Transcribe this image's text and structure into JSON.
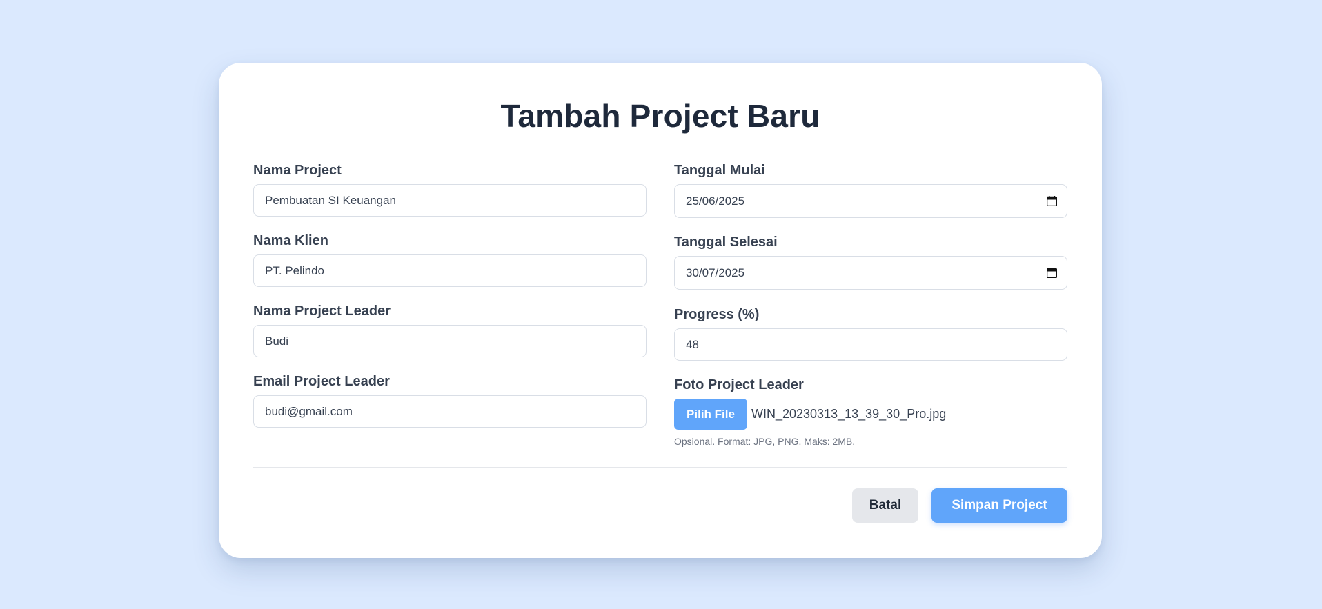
{
  "form": {
    "title": "Tambah Project Baru",
    "nama_project": {
      "label": "Nama Project",
      "value": "Pembuatan SI Keuangan"
    },
    "nama_klien": {
      "label": "Nama Klien",
      "value": "PT. Pelindo"
    },
    "nama_leader": {
      "label": "Nama Project Leader",
      "value": "Budi"
    },
    "email_leader": {
      "label": "Email Project Leader",
      "value": "budi@gmail.com"
    },
    "tanggal_mulai": {
      "label": "Tanggal Mulai",
      "value": "25/06/2025"
    },
    "tanggal_selesai": {
      "label": "Tanggal Selesai",
      "value": "30/07/2025"
    },
    "progress": {
      "label": "Progress (%)",
      "value": "48"
    },
    "foto": {
      "label": "Foto Project Leader",
      "button_label": "Pilih File",
      "file_name": "WIN_20230313_13_39_30_Pro.jpg",
      "hint": "Opsional. Format: JPG, PNG. Maks: 2MB."
    }
  },
  "actions": {
    "cancel_label": "Batal",
    "save_label": "Simpan Project"
  },
  "colors": {
    "background": "#dbe9fe",
    "accent": "#60a5fa",
    "cancel_bg": "#e5e7eb"
  },
  "icons": {
    "date_picker": "calendar-icon"
  }
}
